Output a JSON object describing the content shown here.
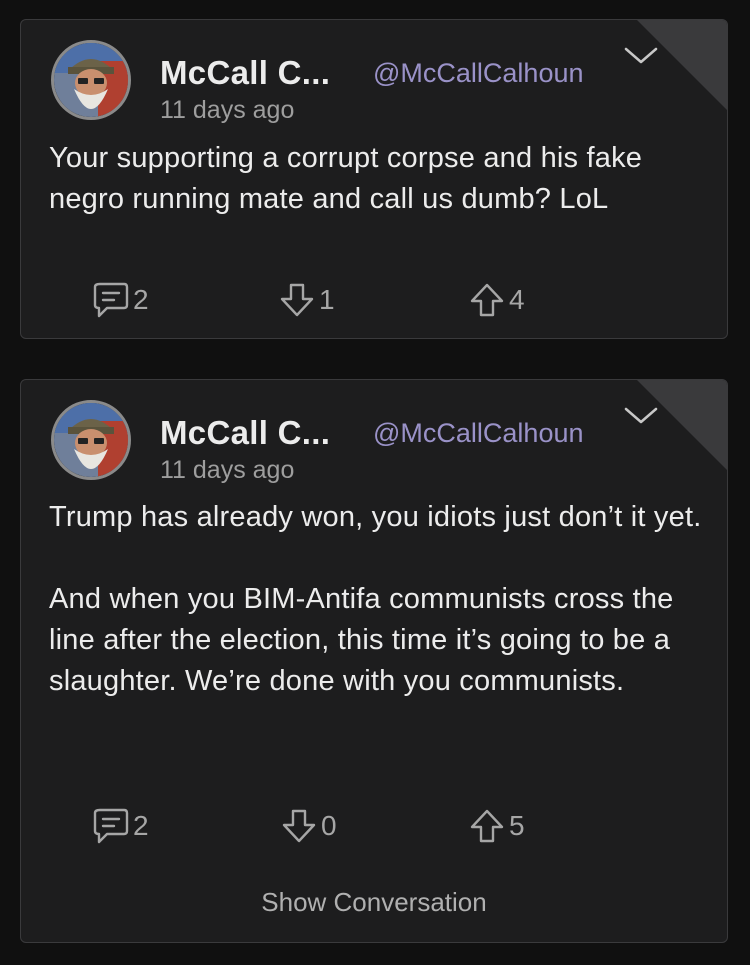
{
  "posts": [
    {
      "author_name": "McCall C...",
      "handle": "@McCallCalhoun",
      "time": "11 days ago",
      "paragraphs": [
        "Your supporting a corrupt corpse and his fake negro running mate and call us dumb? LoL"
      ],
      "comments": "2",
      "downvotes": "1",
      "upvotes": "4"
    },
    {
      "author_name": "McCall C...",
      "handle": "@McCallCalhoun",
      "time": "11 days ago",
      "paragraphs": [
        "Trump has already won, you idiots just don’t it yet.",
        "And when you BIM-Antifa communists cross the line after the election, this time it’s going to be a slaughter. We’re done with you communists."
      ],
      "comments": "2",
      "downvotes": "0",
      "upvotes": "5",
      "show_conversation": "Show Conversation"
    }
  ],
  "colors": {
    "background": "#101010",
    "card": "#1d1d1e",
    "border": "#3a3a3c",
    "handle": "#9a92c8",
    "text": "#ececec",
    "muted": "#a6a6a6"
  },
  "icons": {
    "comment": "comment-bubble-icon",
    "downvote": "arrow-down-icon",
    "upvote": "arrow-up-icon",
    "menu": "chevron-down-icon"
  }
}
